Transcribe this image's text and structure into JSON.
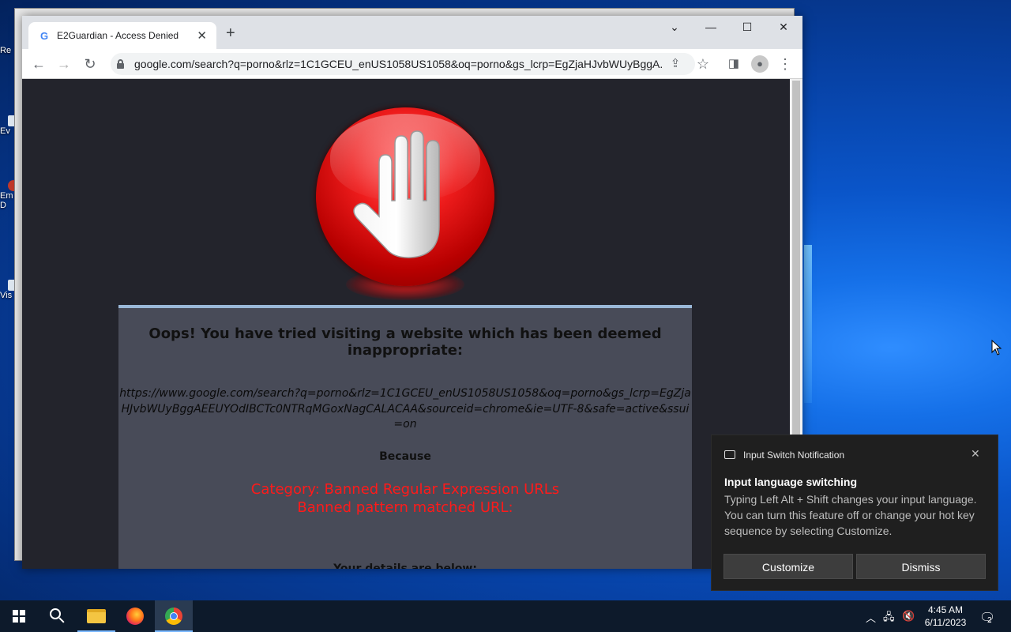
{
  "desktop": {
    "icon_labels": [
      "Re",
      "Ev",
      "Em",
      "D",
      "Vis"
    ]
  },
  "browser": {
    "tab_title": "E2Guardian - Access Denied",
    "tab_favicon": "G",
    "url": "google.com/search?q=porno&rlz=1C1GCEU_enUS1058US1058&oq=porno&gs_lcrp=EgZjaHJvbWUyBggA...",
    "icons": [
      "back-icon",
      "forward-icon",
      "reload-icon",
      "lock-icon",
      "share-icon",
      "star-icon",
      "side-panel-icon",
      "profile-icon",
      "menu-icon"
    ]
  },
  "page": {
    "headline": "Oops! You have tried visiting a website which has been deemed inappropriate:",
    "blocked_url": "https://www.google.com/search?q=porno&rlz=1C1GCEU_enUS1058US1058&oq=porno&gs_lcrp=EgZjaHJvbWUyBggAEEUYOdIBCTc0NTRqMGoxNagCALACAA&sourceid=chrome&ie=UTF-8&safe=active&ssui=on",
    "because": "Because",
    "reason_line1": "Category: Banned Regular Expression URLs",
    "reason_line2": "Banned pattern matched URL:",
    "details": "Your details are below:",
    "colors": {
      "reason": "#ff1a1a",
      "page_bg": "#23242c",
      "box_bg": "#484b58"
    }
  },
  "notification": {
    "app_name": "Input Switch Notification",
    "title": "Input language switching",
    "body": "Typing Left Alt + Shift changes your input language. You can turn this feature off or change your hot key sequence by selecting Customize.",
    "customize_label": "Customize",
    "dismiss_label": "Dismiss"
  },
  "taskbar": {
    "apps": [
      "start",
      "search",
      "file-explorer",
      "firefox",
      "chrome"
    ],
    "time": "4:45 AM",
    "date": "6/11/2023",
    "notification_count": "2"
  }
}
